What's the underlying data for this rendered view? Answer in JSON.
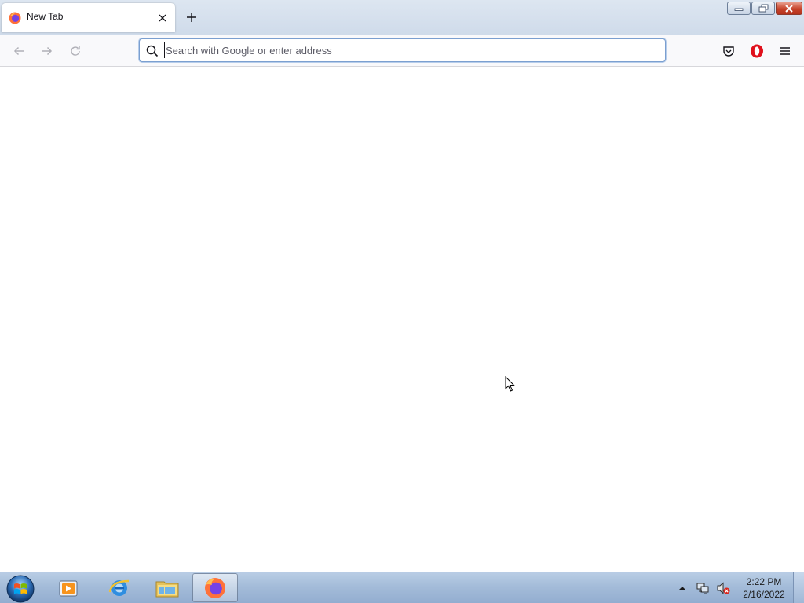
{
  "browser": {
    "tab": {
      "title": "New Tab"
    },
    "urlbar": {
      "placeholder": "Search with Google or enter address",
      "value": ""
    },
    "icons": {
      "back": "back-arrow-icon",
      "forward": "forward-arrow-icon",
      "reload": "reload-icon",
      "search": "search-icon",
      "pocket": "pocket-icon",
      "extension": "opera-extension-icon",
      "menu": "hamburger-menu-icon"
    }
  },
  "window_controls": {
    "minimize": "minimize",
    "maximize": "restore",
    "close": "close"
  },
  "taskbar": {
    "items": [
      {
        "name": "media-player",
        "active": false
      },
      {
        "name": "internet-explorer",
        "active": false
      },
      {
        "name": "file-explorer",
        "active": false
      },
      {
        "name": "firefox",
        "active": true
      }
    ],
    "clock": {
      "time": "2:22 PM",
      "date": "2/16/2022"
    }
  },
  "colors": {
    "accent": "#7b9fd0",
    "firefox_orange": "#ff7139",
    "close_red": "#c6432b"
  }
}
